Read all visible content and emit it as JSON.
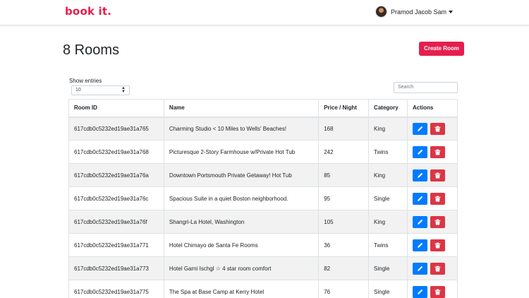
{
  "navbar": {
    "brand": "book it.",
    "user_name": "Pramod Jacob Sam"
  },
  "page": {
    "title": "8 Rooms",
    "create_button": "Create Room"
  },
  "controls": {
    "show_entries_label": "Show entries",
    "entries_value": "10",
    "search_placeholder": "Search"
  },
  "table": {
    "headers": [
      "Room ID",
      "Name",
      "Price / Night",
      "Category",
      "Actions"
    ],
    "rows": [
      {
        "id": "617cdb0c5232ed19ae31a765",
        "name": "Charming Studio < 10 Miles to Wells' Beaches!",
        "price": "168",
        "category": "King"
      },
      {
        "id": "617cdb0c5232ed19ae31a768",
        "name": "Picturesque 2-Story Farmhouse w/Private Hot Tub",
        "price": "242",
        "category": "Twins"
      },
      {
        "id": "617cdb0c5232ed19ae31a76a",
        "name": "Downtown Portsmouth Private Getaway! Hot Tub",
        "price": "85",
        "category": "King"
      },
      {
        "id": "617cdb0c5232ed19ae31a76c",
        "name": "Spacious Suite in a quiet Boston neighborhood.",
        "price": "95",
        "category": "Single"
      },
      {
        "id": "617cdb0c5232ed19ae31a76f",
        "name": "Shangri-La Hotel, Washington",
        "price": "105",
        "category": "King"
      },
      {
        "id": "617cdb0c5232ed19ae31a771",
        "name": "Hotel Chimayo de Santa Fe Rooms",
        "price": "36",
        "category": "Twins"
      },
      {
        "id": "617cdb0c5232ed19ae31a773",
        "name": "Hotel Garni Ischgl ☆ 4 star room comfort",
        "price": "82",
        "category": "Single"
      },
      {
        "id": "617cdb0c5232ed19ae31a775",
        "name": "The Spa at Base Camp at Kerry Hotel",
        "price": "76",
        "category": "Single"
      }
    ]
  },
  "icons": {
    "edit": "pencil-icon",
    "delete": "trash-icon"
  },
  "colors": {
    "brand": "#e61e4d",
    "edit_button": "#007bff",
    "delete_button": "#dc3545"
  }
}
